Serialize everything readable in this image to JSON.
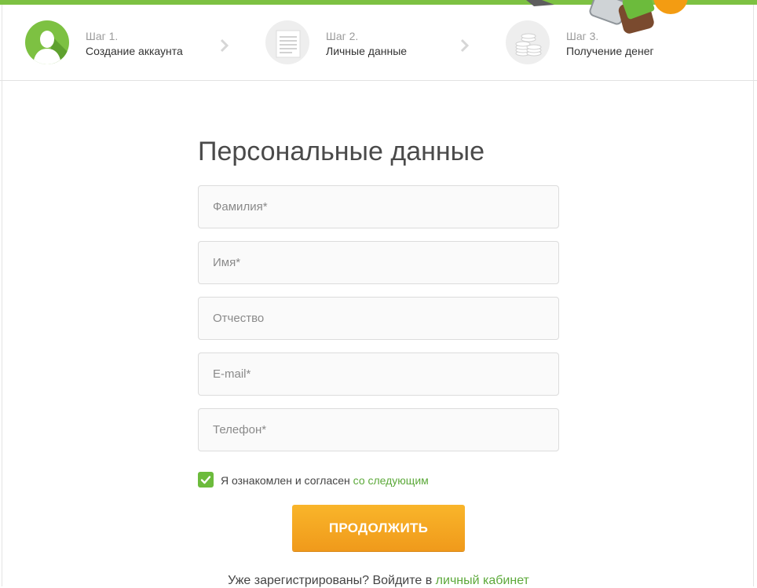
{
  "colors": {
    "accent_green": "#7dc142",
    "link_green": "#5ca93a",
    "button_orange": "#f5a623",
    "text_dark": "#4a4a4a",
    "text_muted": "#9b9b9b"
  },
  "steps": [
    {
      "number": "Шаг 1.",
      "title": "Создание аккаунта",
      "icon": "user-avatar-icon",
      "state": "active"
    },
    {
      "number": "Шаг 2.",
      "title": "Личные данные",
      "icon": "document-icon",
      "state": "inactive"
    },
    {
      "number": "Шаг 3.",
      "title": "Получение денег",
      "icon": "coins-icon",
      "state": "inactive"
    }
  ],
  "form": {
    "title": "Персональные данные",
    "fields": {
      "last_name": {
        "placeholder": "Фамилия*",
        "value": ""
      },
      "first_name": {
        "placeholder": "Имя*",
        "value": ""
      },
      "middle_name": {
        "placeholder": "Отчество",
        "value": ""
      },
      "email": {
        "placeholder": "E-mail*",
        "value": ""
      },
      "phone": {
        "placeholder": "Телефон*",
        "value": ""
      }
    },
    "agreement": {
      "checked": true,
      "text": "Я ознакомлен и согласен",
      "link": "со следующим"
    },
    "submit_label": "ПРОДОЛЖИТЬ"
  },
  "login": {
    "prompt": "Уже зарегистрированы? Войдите в",
    "link": "личный кабинет"
  }
}
